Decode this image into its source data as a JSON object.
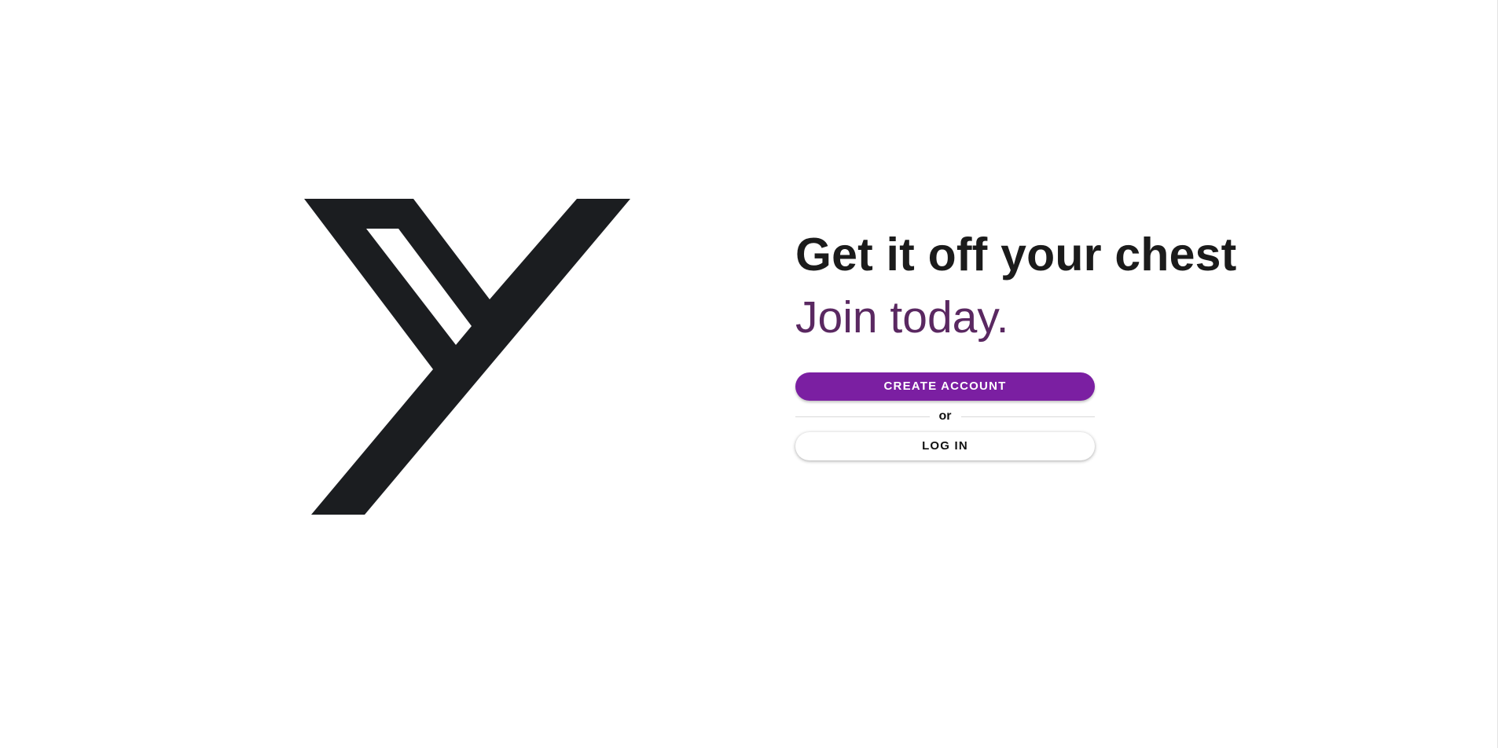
{
  "hero": {
    "headline": "Get it off your chest",
    "subhead": "Join today."
  },
  "actions": {
    "create_account_label": "CREATE ACCOUNT",
    "divider_text": "or",
    "login_label": "LOG IN"
  },
  "logo": {
    "icon": "y-logo-icon",
    "color": "#1b1d20"
  },
  "colors": {
    "accent": "#7b1fa2",
    "subhead": "#5a2861",
    "headline": "#1b1b1b",
    "background": "#ffffff"
  }
}
